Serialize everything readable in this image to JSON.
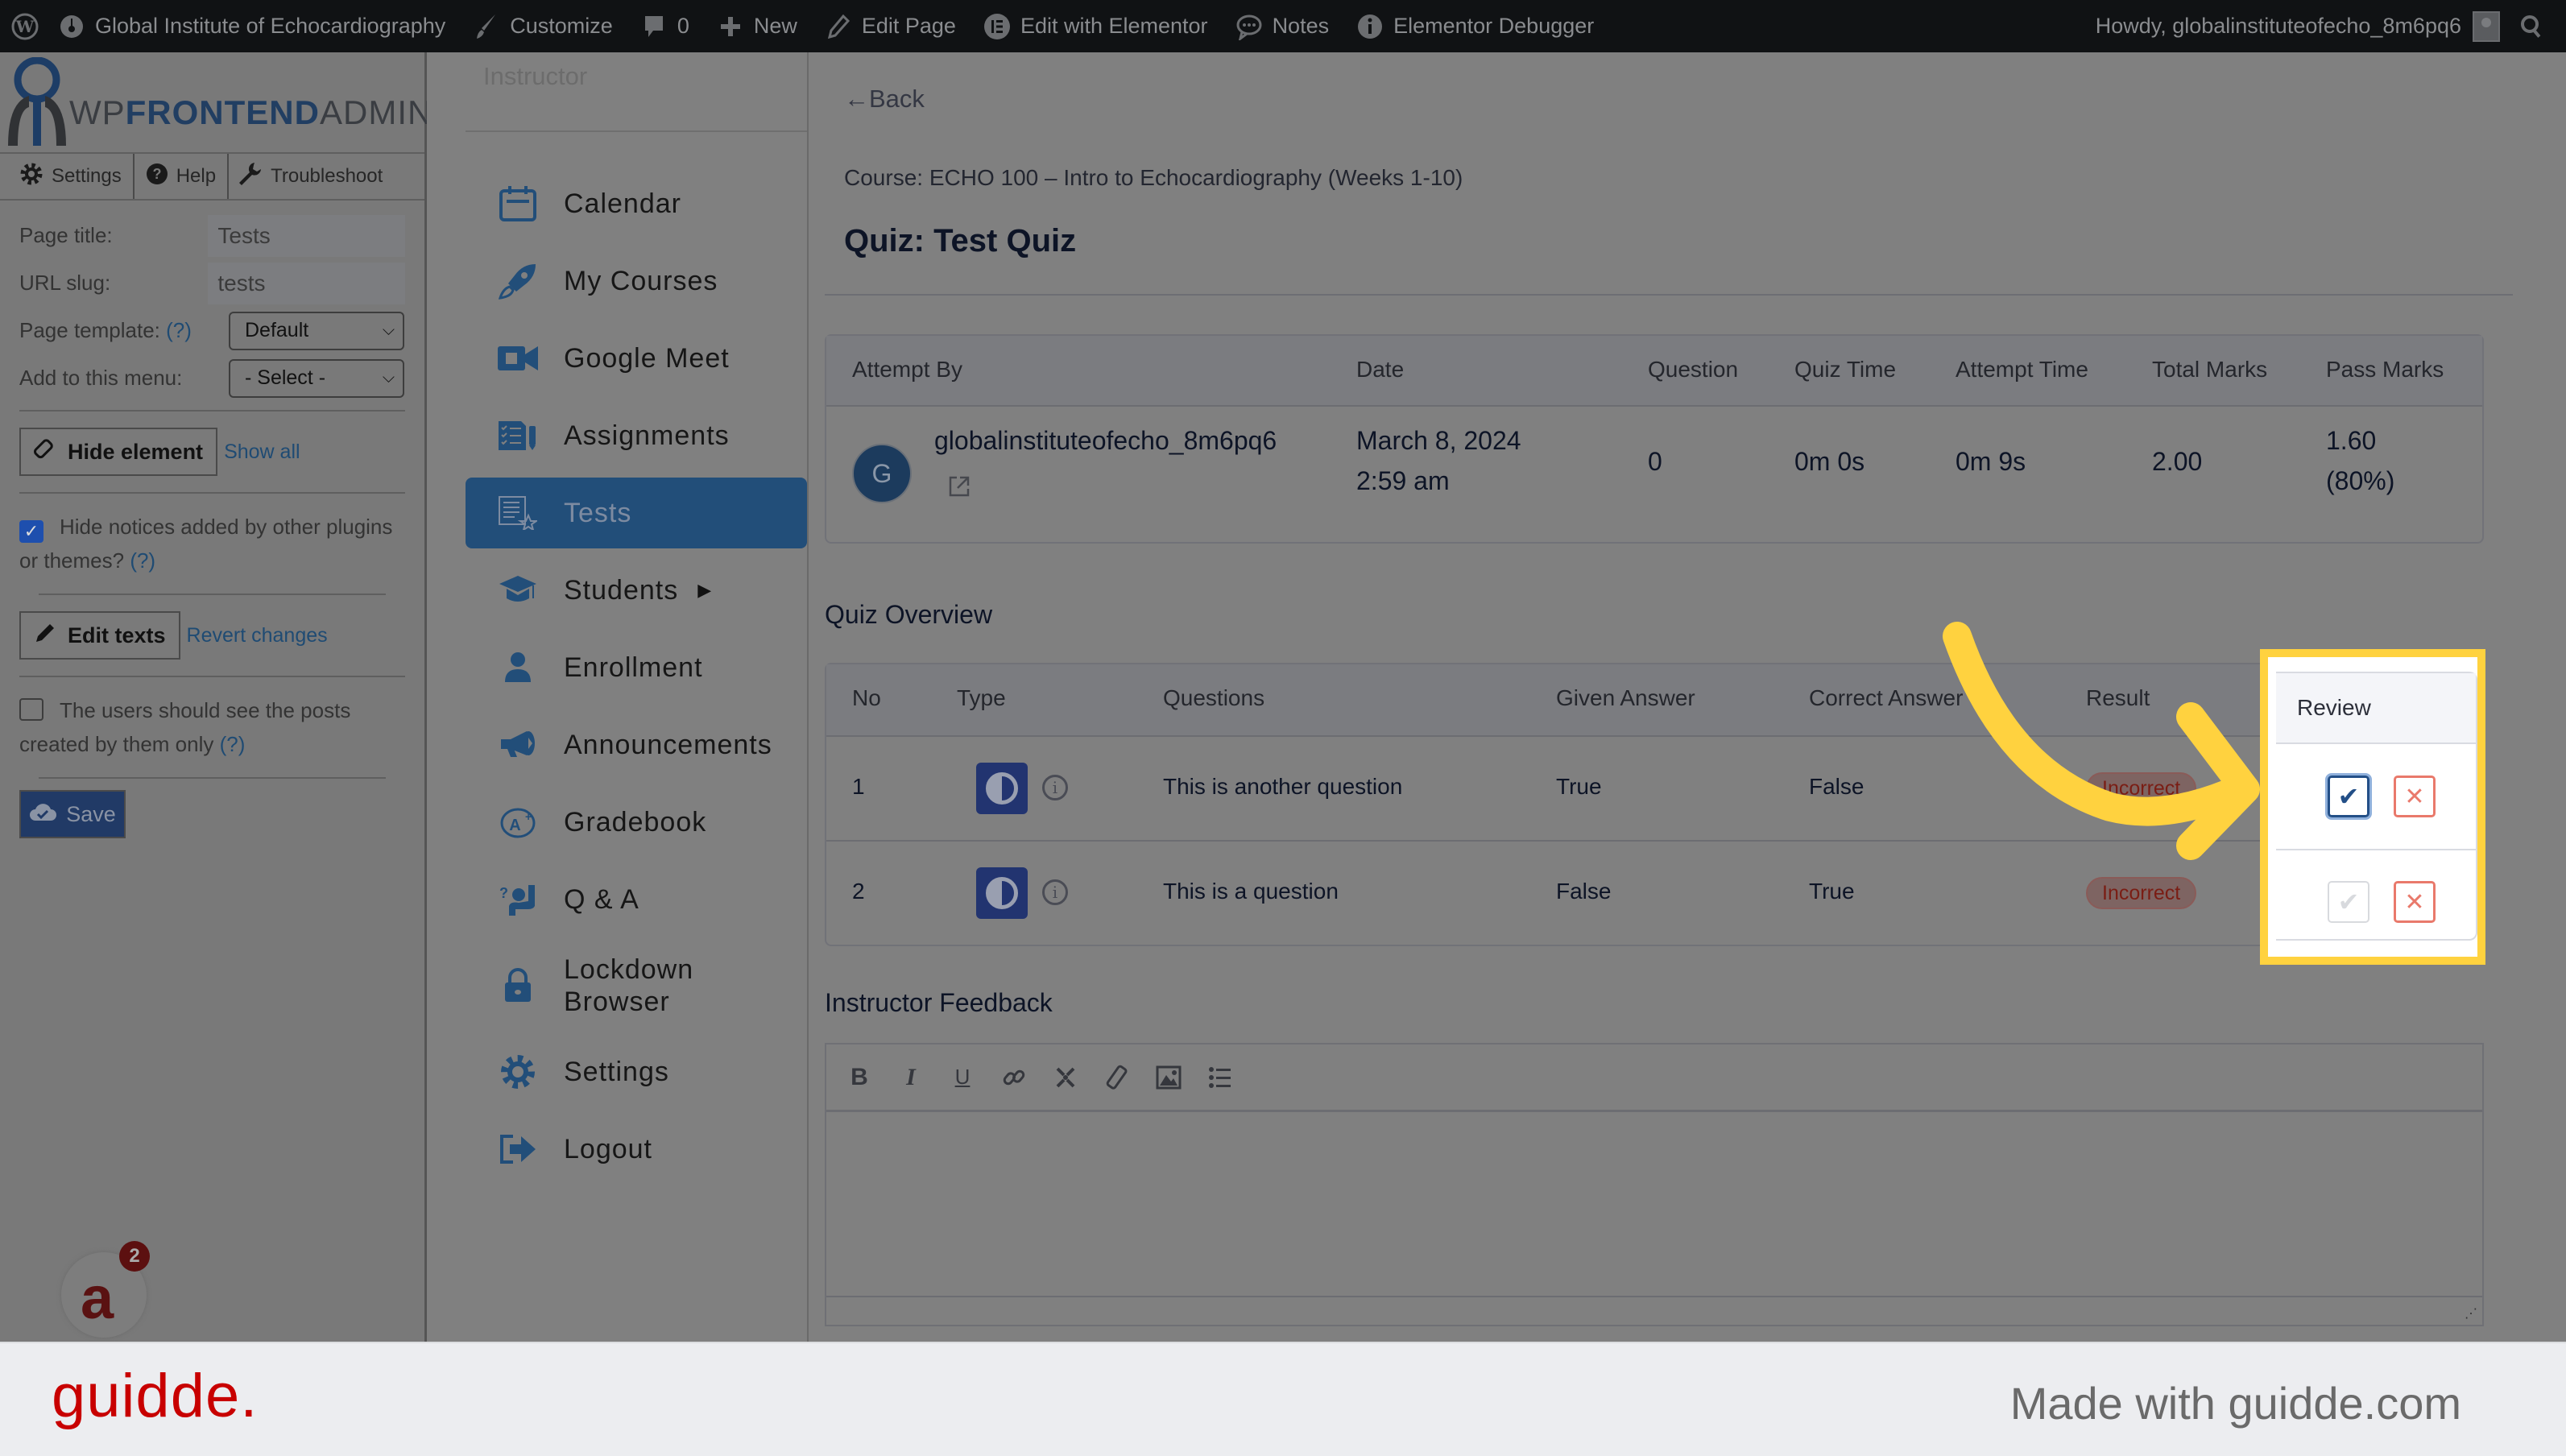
{
  "admin_bar": {
    "site_name": "Global Institute of Echocardiography",
    "customize": "Customize",
    "comments_count": "0",
    "new": "New",
    "edit_page": "Edit Page",
    "edit_elementor": "Edit with Elementor",
    "notes": "Notes",
    "debugger": "Elementor Debugger",
    "howdy": "Howdy, globalinstituteofecho_8m6pq6"
  },
  "wpfa": {
    "logo_prefix": "WP",
    "logo_bold": "FRONTEND",
    "logo_suffix": "ADMIN",
    "logo_reg": "®",
    "tabs": [
      {
        "label": "Settings",
        "icon": "gear-icon"
      },
      {
        "label": "Help",
        "icon": "help-icon"
      },
      {
        "label": "Troubleshoot",
        "icon": "wrench-icon"
      }
    ],
    "page_title_label": "Page title:",
    "page_title_value": "Tests",
    "url_slug_label": "URL slug:",
    "url_slug_value": "tests",
    "page_template_label": "Page template:",
    "help_mark": "(?)",
    "page_template_value": "Default",
    "menu_label": "Add to this menu:",
    "menu_value": "- Select -",
    "hide_element": "Hide element",
    "show_all": "Show all",
    "hide_notices": "Hide notices added by other plugins or themes?",
    "hide_notices_checked": true,
    "edit_texts": "Edit texts",
    "revert_changes": "Revert changes",
    "own_posts": "The users should see the posts created by them only",
    "own_posts_checked": false,
    "save": "Save",
    "notification_count": "2"
  },
  "nav": {
    "section_title": "Instructor",
    "items": [
      {
        "label": "Calendar",
        "icon": "calendar-icon",
        "active": false
      },
      {
        "label": "My Courses",
        "icon": "rocket-icon",
        "active": false
      },
      {
        "label": "Google Meet",
        "icon": "video-camera-icon",
        "active": false
      },
      {
        "label": "Assignments",
        "icon": "assignments-icon",
        "active": false
      },
      {
        "label": "Tests",
        "icon": "tests-icon",
        "active": true
      },
      {
        "label": "Students",
        "icon": "graduation-cap-icon",
        "active": false,
        "has_submenu": true
      },
      {
        "label": "Enrollment",
        "icon": "user-icon",
        "active": false
      },
      {
        "label": "Announcements",
        "icon": "megaphone-icon",
        "active": false
      },
      {
        "label": "Gradebook",
        "icon": "grade-icon",
        "active": false
      },
      {
        "label": "Q & A",
        "icon": "question-hand-icon",
        "active": false
      },
      {
        "label": "Lockdown Browser",
        "icon": "lock-icon",
        "active": false
      },
      {
        "label": "Settings",
        "icon": "gear-icon",
        "active": false
      },
      {
        "label": "Logout",
        "icon": "logout-icon",
        "active": false
      }
    ]
  },
  "main": {
    "back": "←Back",
    "course": "Course: ECHO 100 – Intro to Echocardiography (Weeks 1-10)",
    "quiz_title": "Quiz: Test Quiz",
    "attempt_table": {
      "headers": [
        "Attempt By",
        "Date",
        "Question",
        "Quiz Time",
        "Attempt Time",
        "Total Marks",
        "Pass Marks"
      ],
      "row": {
        "avatar_initial": "G",
        "user": "globalinstituteofecho_8m6pq6",
        "date": "March 8, 2024",
        "time": "2:59 am",
        "question": "0",
        "quiz_time": "0m 0s",
        "attempt_time": "0m 9s",
        "total_marks": "2.00",
        "pass_marks": "1.60",
        "pass_percent": "(80%)"
      }
    },
    "overview_title": "Quiz Overview",
    "overview_table": {
      "headers": [
        "No",
        "Type",
        "Questions",
        "Given Answer",
        "Correct Answer",
        "Result",
        "Review"
      ],
      "rows": [
        {
          "no": "1",
          "question": "This is another question",
          "given": "True",
          "correct": "False",
          "result": "Incorrect",
          "review_approved": true
        },
        {
          "no": "2",
          "question": "This is a question",
          "given": "False",
          "correct": "True",
          "result": "Incorrect",
          "review_approved": false
        }
      ]
    },
    "feedback_title": "Instructor Feedback",
    "toolbar": [
      "bold-icon",
      "italic-icon",
      "underline-icon",
      "link-icon",
      "unlink-icon",
      "eraser-icon",
      "image-icon",
      "list-icon"
    ]
  },
  "footer": {
    "logo": "guidde.",
    "made_with": "Made with guidde.com"
  },
  "colors": {
    "accent": "#224e79",
    "highlight": "#ffd23f",
    "incorrect": "#7a1d14",
    "brand": "#c80000"
  }
}
